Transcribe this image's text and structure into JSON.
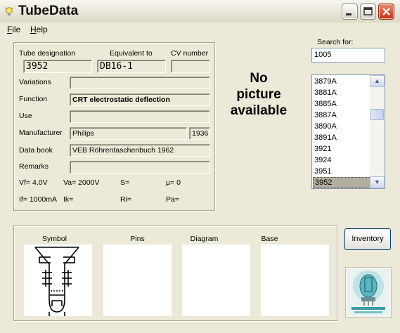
{
  "window": {
    "title": "TubeData"
  },
  "menu": {
    "file_u": "F",
    "file_rest": "ile",
    "help_u": "H",
    "help_rest": "elp"
  },
  "tube": {
    "designation_label": "Tube designation",
    "equivalent_label": "Equivalent to",
    "cv_label": "CV number",
    "designation": "3952",
    "equivalent": "DB16-1",
    "cv": "",
    "variations_label": "Variations",
    "variations": "",
    "function_label": "Function",
    "function": "CRT electrostatic deflection",
    "use_label": "Use",
    "use": "",
    "manufacturer_label": "Manufacturer",
    "manufacturer": "Philips",
    "year": "1936",
    "databook_label": "Data book",
    "databook": "VEB Röhrentaschenbuch 1962",
    "remarks_label": "Remarks",
    "remarks": "",
    "vf": "Vf= 4.0V",
    "va": "Va= 2000V",
    "s": "S=",
    "mu": "µ=   0",
    "if": "If= 1000mA",
    "ik": "Ik=",
    "ri": "Ri=",
    "pa": "Pa="
  },
  "picture": {
    "line1": "No",
    "line2": "picture",
    "line3": "available"
  },
  "search": {
    "label": "Search for:",
    "value": "1005",
    "items": [
      "3879A",
      "3881A",
      "3885A",
      "3887A",
      "3890A",
      "3891A",
      "3921",
      "3924",
      "3951",
      "3952"
    ],
    "selected": "3952"
  },
  "panels": {
    "symbol": "Symbol",
    "pins": "Pins",
    "diagram": "Diagram",
    "base": "Base"
  },
  "inventory_button": "Inventory",
  "colors": {
    "titlebar_bg": "#dcd9c6",
    "window_bg": "#ece9d8",
    "close_red": "#c2351b",
    "selection": "#b3afa0"
  }
}
